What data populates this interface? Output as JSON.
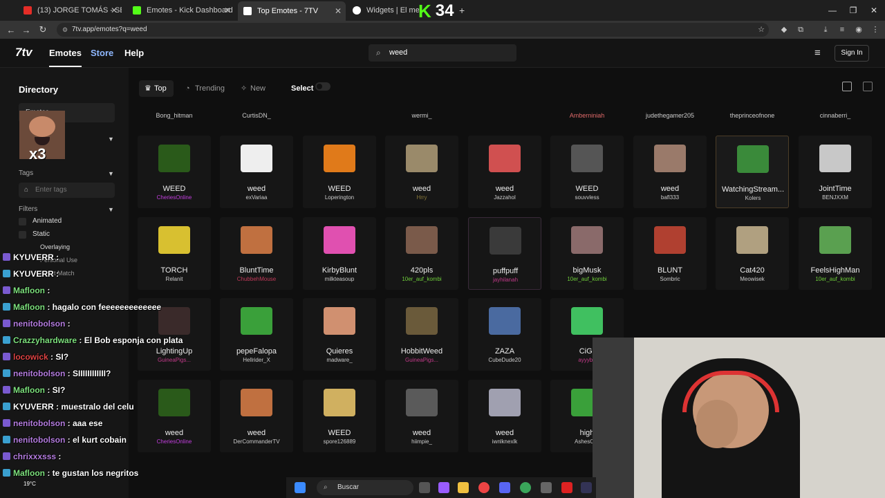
{
  "browser": {
    "tabs": [
      {
        "title": "(13) JORGE TOMÁS - SET D...",
        "favicon_color": "#e52d27"
      },
      {
        "title": "Emotes - Kick Dashboard",
        "favicon_color": "#53fc18"
      },
      {
        "title": "Top Emotes - 7TV",
        "favicon_color": "#ffffff",
        "active": true
      },
      {
        "title": "Widgets | El mejor softw...",
        "favicon_color": "#ffffff"
      }
    ],
    "new_tab": "+",
    "url": "7tv.app/emotes?q=weed"
  },
  "kick_overlay": {
    "logo": "K",
    "viewers": "34"
  },
  "app": {
    "logo": "7tv",
    "nav": [
      "Emotes",
      "Store",
      "Help"
    ],
    "search_value": "weed",
    "sign_in": "Sign In"
  },
  "sidebar": {
    "title": "Directory",
    "tab_emotes": "Emotes",
    "tags_label": "Tags",
    "tags_placeholder": "Enter tags",
    "filters_label": "Filters",
    "filters": [
      "Animated",
      "Static",
      "Overlaying",
      "Personal Use",
      "Exact Match"
    ]
  },
  "toolbar": {
    "filters": [
      "Top",
      "Trending",
      "New"
    ],
    "select_label": "Select"
  },
  "top_row_authors": [
    "Bong_hitman",
    "CurtisDN_",
    "",
    "wermi_",
    "",
    "Amberniniah",
    "judethegamer205",
    "theprinceofnone",
    "cinnaberri_"
  ],
  "emote_rows": [
    [
      {
        "name": "WEED",
        "author": "CheriesOnline",
        "author_color": "#c43fe0"
      },
      {
        "name": "weed",
        "author": "exVariaa",
        "author_color": "#cccccc"
      },
      {
        "name": "WEED",
        "author": "Loperington",
        "author_color": "#cccccc"
      },
      {
        "name": "weed",
        "author": "Hrry",
        "author_color": "#8a7a3a"
      },
      {
        "name": "weed",
        "author": "Jazzahol",
        "author_color": "#cccccc"
      },
      {
        "name": "WEED",
        "author": "souvvless",
        "author_color": "#cccccc"
      },
      {
        "name": "weed",
        "author": "bafl333",
        "author_color": "#cccccc"
      },
      {
        "name": "WatchingStream...",
        "author": "Kolers",
        "author_color": "#cccccc"
      },
      {
        "name": "JointTime",
        "author": "BENJXXM",
        "author_color": "#cccccc"
      }
    ],
    [
      {
        "name": "TORCH",
        "author": "Relanit",
        "author_color": "#cccccc"
      },
      {
        "name": "BluntTime",
        "author": "ChubbehMouse",
        "author_color": "#c23a5a"
      },
      {
        "name": "KirbyBlunt",
        "author": "milkteasoup",
        "author_color": "#cccccc"
      },
      {
        "name": "420pls",
        "author": "10er_auf_kombi",
        "author_color": "#6fcf3a"
      },
      {
        "name": "puffpuff",
        "author": "jayhilanah",
        "author_color": "#c23a8a"
      },
      {
        "name": "bigMusk",
        "author": "10er_auf_kombi",
        "author_color": "#6fcf3a"
      },
      {
        "name": "BLUNT",
        "author": "Sombric",
        "author_color": "#cccccc"
      },
      {
        "name": "Cat420",
        "author": "Meowisek",
        "author_color": "#cccccc"
      },
      {
        "name": "FeelsHighMan",
        "author": "10er_auf_kombi",
        "author_color": "#6fcf3a"
      }
    ],
    [
      {
        "name": "LightingUp",
        "author": "GuineaPigs...",
        "author_color": "#c23a8a"
      },
      {
        "name": "pepeFalopa",
        "author": "Hellrider_X",
        "author_color": "#cccccc"
      },
      {
        "name": "Quieres",
        "author": "madware_",
        "author_color": "#cccccc"
      },
      {
        "name": "HobbitWeed",
        "author": "GuineaPigs...",
        "author_color": "#c23a8a"
      },
      {
        "name": "ZAZA",
        "author": "CubeDude20",
        "author_color": "#cccccc"
      },
      {
        "name": "CiGr",
        "author": "ayyybu",
        "author_color": "#c23a8a"
      }
    ],
    [
      {
        "name": "weed",
        "author": "CheriesOnline",
        "author_color": "#c43fe0"
      },
      {
        "name": "weed",
        "author": "DerCommanderTV",
        "author_color": "#cccccc"
      },
      {
        "name": "WEED",
        "author": "spore126889",
        "author_color": "#cccccc"
      },
      {
        "name": "weed",
        "author": "hiimpie_",
        "author_color": "#cccccc"
      },
      {
        "name": "weed",
        "author": "iwnlknexlk",
        "author_color": "#cccccc"
      },
      {
        "name": "high",
        "author": "AshesOfA",
        "author_color": "#cccccc"
      }
    ]
  ],
  "chat": [
    {
      "user": "KYUVERR",
      "msg": ": ",
      "color": "#ffffff"
    },
    {
      "user": "KYUVERR",
      "msg": ":",
      "color": "#ffffff"
    },
    {
      "user": "Mafloon",
      "msg": ": ",
      "color": "#7de07d"
    },
    {
      "user": "Mafloon",
      "msg": ": hagalo con feeeeeeeeeeeee",
      "color": "#7de07d"
    },
    {
      "user": "nenitobolson",
      "msg": ":",
      "color": "#b57de0"
    },
    {
      "user": "Crazzyhardware",
      "msg": ": El Bob esponja con plata",
      "color": "#7de07d"
    },
    {
      "user": "locowick",
      "msg": ": SI?",
      "color": "#e04545"
    },
    {
      "user": "nenitobolson",
      "msg": ": SIIIIIIIIIIII?",
      "color": "#b57de0"
    },
    {
      "user": "Mafloon",
      "msg": ": SI?",
      "color": "#7de07d"
    },
    {
      "user": "KYUVERR",
      "msg": ": muestralo del celu",
      "color": "#ffffff"
    },
    {
      "user": "nenitobolson",
      "msg": ": aaa ese",
      "color": "#b57de0"
    },
    {
      "user": "nenitobolson",
      "msg": ": el kurt cobain",
      "color": "#b57de0"
    },
    {
      "user": "chrixxxsss",
      "msg": ":",
      "color": "#b57de0"
    },
    {
      "user": "Mafloon",
      "msg": ": te gustan los negritos",
      "color": "#7de07d"
    }
  ],
  "taskbar": {
    "search": "Buscar",
    "weather": "19°C"
  }
}
